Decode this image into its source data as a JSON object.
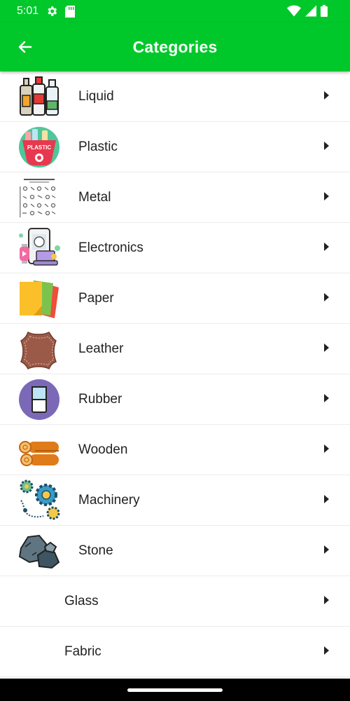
{
  "status": {
    "time": "5:01"
  },
  "app_bar": {
    "title": "Categories",
    "back_icon": "arrow-left-icon"
  },
  "categories": [
    {
      "label": "Liquid",
      "icon": "bottles-icon"
    },
    {
      "label": "Plastic",
      "icon": "plastic-basket-icon"
    },
    {
      "label": "Metal",
      "icon": "metal-products-icon"
    },
    {
      "label": "Electronics",
      "icon": "devices-icon"
    },
    {
      "label": "Paper",
      "icon": "paper-sheets-icon"
    },
    {
      "label": "Leather",
      "icon": "leather-patch-icon"
    },
    {
      "label": "Rubber",
      "icon": "rubber-eraser-icon"
    },
    {
      "label": "Wooden",
      "icon": "wood-logs-icon"
    },
    {
      "label": "Machinery",
      "icon": "gears-icon"
    },
    {
      "label": "Stone",
      "icon": "stones-icon"
    },
    {
      "label": "Glass",
      "icon": ""
    },
    {
      "label": "Fabric",
      "icon": ""
    }
  ],
  "colors": {
    "primary": "#00c82a",
    "text": "#222222",
    "divider": "#ececec"
  }
}
